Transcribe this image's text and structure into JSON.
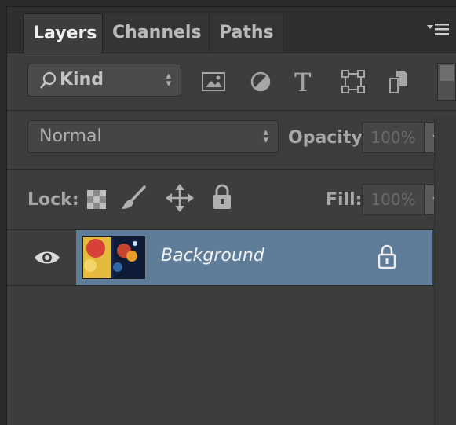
{
  "tabs": [
    {
      "label": "Layers",
      "active": true
    },
    {
      "label": "Channels",
      "active": false
    },
    {
      "label": "Paths",
      "active": false
    }
  ],
  "filter": {
    "kind_label": "Kind",
    "icons": [
      "image-filter-icon",
      "adjustment-filter-icon",
      "type-filter-icon",
      "shape-filter-icon",
      "smart-object-filter-icon"
    ]
  },
  "blend": {
    "mode": "Normal",
    "opacity_label": "Opacity:",
    "opacity_value": "100%"
  },
  "lock": {
    "label": "Lock:",
    "fill_label": "Fill:",
    "fill_value": "100%"
  },
  "layers": [
    {
      "name": "Background",
      "visible": true,
      "locked": true,
      "selected": true
    }
  ],
  "colors": {
    "panel_bg": "#3d3d3d",
    "selected_row": "#5f7d99"
  }
}
